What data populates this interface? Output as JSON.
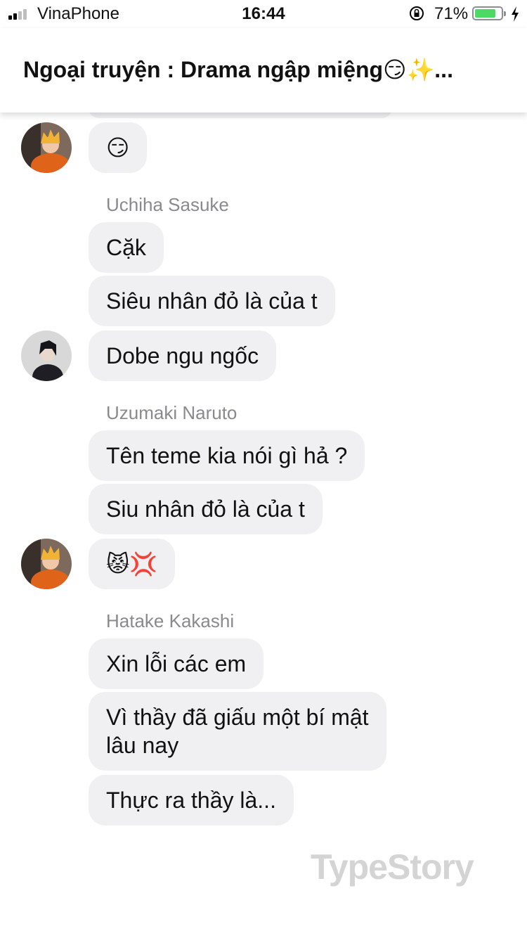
{
  "status_bar": {
    "carrier": "VinaPhone",
    "time": "16:44",
    "battery_percent": "71%"
  },
  "header": {
    "title": "Ngoại truyện : Drama ngập miệng😏✨..."
  },
  "messages": [
    {
      "id": "m1",
      "text": "😏"
    },
    {
      "id": "m2",
      "sender": "Uchiha Sasuke",
      "text": "Cặk"
    },
    {
      "id": "m3",
      "text": "Siêu nhân đỏ là của t"
    },
    {
      "id": "m4",
      "text": "Dobe ngu ngốc"
    },
    {
      "id": "m5",
      "sender": "Uzumaki Naruto",
      "text": "Tên teme kia nói gì hả ?"
    },
    {
      "id": "m6",
      "text": "Siu nhân đỏ là của t"
    },
    {
      "id": "m7",
      "text": "😾💢"
    },
    {
      "id": "m8",
      "sender": "Hatake Kakashi",
      "text": "Xin lỗi các em"
    },
    {
      "id": "m9",
      "text_line1": "Vì thầy đã giấu một bí mật",
      "text_line2": "lâu nay"
    },
    {
      "id": "m10",
      "text": "Thực ra thầy là..."
    }
  ],
  "watermark": "TypeStory",
  "colors": {
    "bubble": "#f0f0f2",
    "sender_name": "#8a8a8e",
    "battery": "#4cd964",
    "watermark": "#d4d4d4"
  },
  "icons": [
    "signal-icon",
    "rotation-lock-icon",
    "battery-icon",
    "charging-bolt-icon"
  ]
}
